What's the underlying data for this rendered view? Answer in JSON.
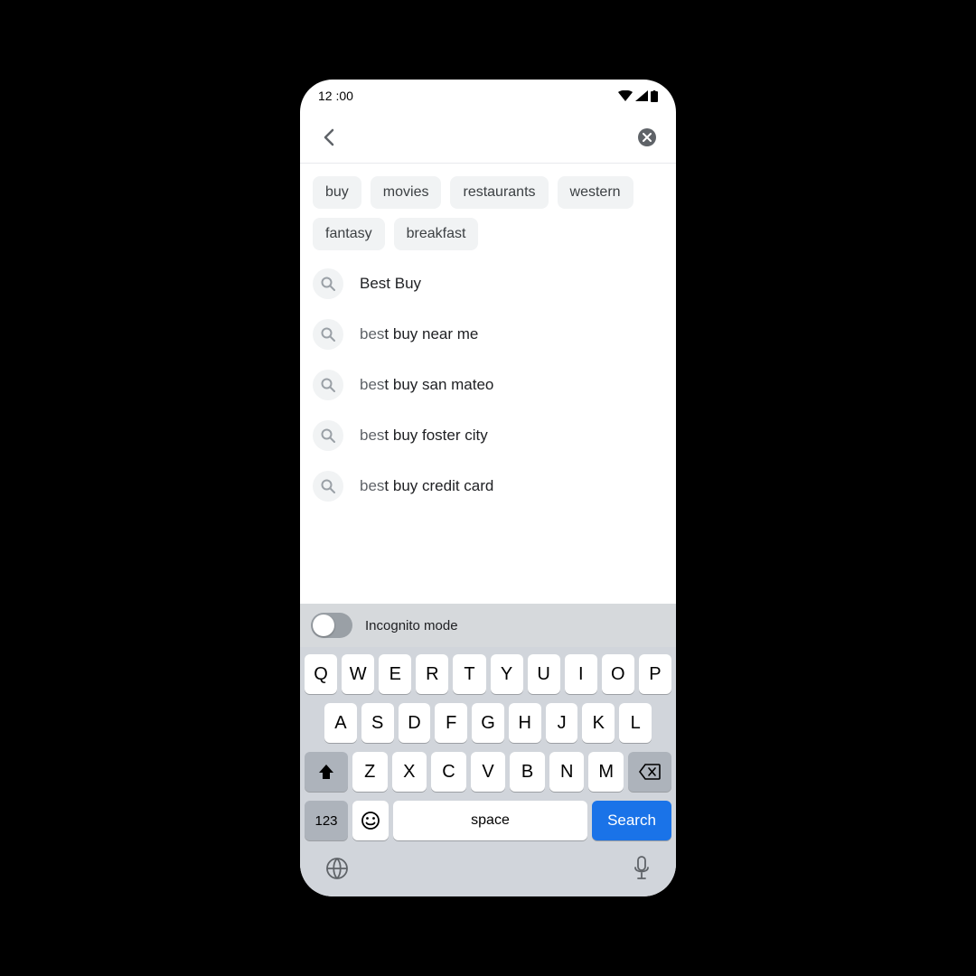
{
  "statusbar": {
    "time": "12 :00"
  },
  "chips": [
    "buy",
    "movies",
    "restaurants",
    "western",
    "fantasy",
    "breakfast"
  ],
  "suggestions": [
    {
      "prefix": "",
      "match": "Best Buy"
    },
    {
      "prefix": "bes",
      "match": "t buy near me"
    },
    {
      "prefix": "bes",
      "match": "t buy san mateo"
    },
    {
      "prefix": "bes",
      "match": "t buy foster city"
    },
    {
      "prefix": "bes",
      "match": "t buy credit card"
    }
  ],
  "incognito": {
    "label": "Incognito mode",
    "enabled": false
  },
  "keyboard": {
    "row1": [
      "Q",
      "W",
      "E",
      "R",
      "T",
      "Y",
      "U",
      "I",
      "O",
      "P"
    ],
    "row2": [
      "A",
      "S",
      "D",
      "F",
      "G",
      "H",
      "J",
      "K",
      "L"
    ],
    "row3": [
      "Z",
      "X",
      "C",
      "V",
      "B",
      "N",
      "M"
    ],
    "numKey": "123",
    "spaceKey": "space",
    "searchKey": "Search"
  }
}
